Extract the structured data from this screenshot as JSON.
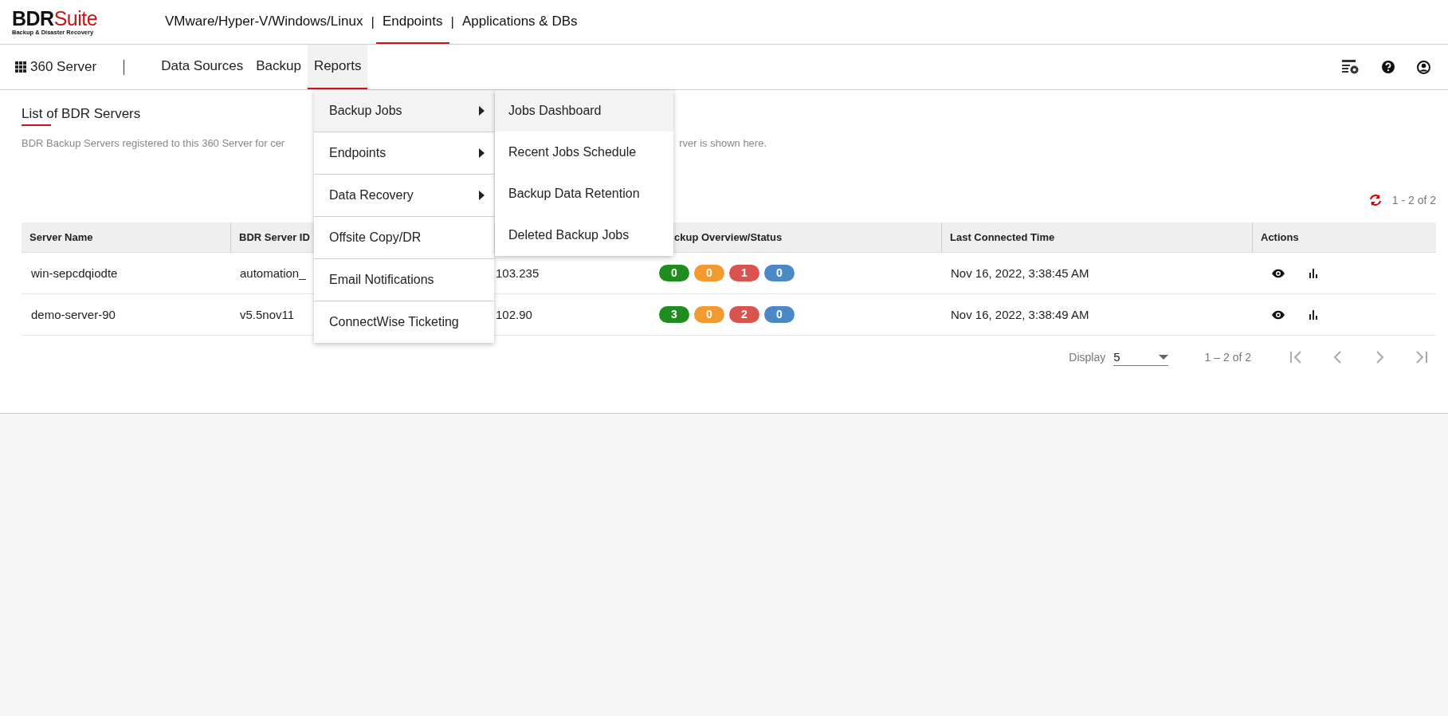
{
  "logo": {
    "brand_dark": "BDR",
    "brand_red": "Suite",
    "tagline": "Backup & Disaster Recovery"
  },
  "top_nav_separators": [
    "|",
    "|"
  ],
  "top_nav": [
    {
      "label": "VMware/Hyper-V/Windows/Linux",
      "selected": false
    },
    {
      "label": "Endpoints",
      "selected": true
    },
    {
      "label": "Applications & DBs",
      "selected": false
    }
  ],
  "sub_nav": {
    "app": "360 Server",
    "items": [
      {
        "label": "Data Sources",
        "selected": false
      },
      {
        "label": "Backup",
        "selected": false
      },
      {
        "label": "Reports",
        "selected": true
      }
    ]
  },
  "reports_menu": [
    {
      "label": "Backup Jobs",
      "selected": true,
      "submenu": true
    },
    {
      "label": "Endpoints",
      "selected": false,
      "submenu": true
    },
    {
      "label": "Data Recovery",
      "selected": false,
      "submenu": true
    },
    {
      "label": "Offsite Copy/DR",
      "selected": false,
      "submenu": false
    },
    {
      "label": "Email Notifications",
      "selected": false,
      "submenu": false
    },
    {
      "label": "ConnectWise Ticketing",
      "selected": false,
      "submenu": false
    }
  ],
  "backup_jobs_submenu": [
    {
      "label": "Jobs Dashboard",
      "selected": true
    },
    {
      "label": "Recent Jobs Schedule",
      "selected": false
    },
    {
      "label": "Backup Data Retention",
      "selected": false
    },
    {
      "label": "Deleted Backup Jobs",
      "selected": false
    }
  ],
  "page": {
    "title": "List of BDR Servers",
    "description_start": "BDR Backup Servers registered to this 360 Server for cer",
    "description_end": "rver is shown here.",
    "range": "1 - 2 of 2"
  },
  "table": {
    "columns": [
      "Server Name",
      "BDR Server ID",
      "",
      "ckup Overview/Status",
      "Last Connected Time",
      "Actions"
    ],
    "rows": [
      {
        "server_name": "win-sepcdqiodte",
        "server_id": "automation_",
        "column_3": "103.235",
        "status": [
          {
            "count": "0",
            "color": "#1e8c1e"
          },
          {
            "count": "0",
            "color": "#f39a2e"
          },
          {
            "count": "1",
            "color": "#d9534f"
          },
          {
            "count": "0",
            "color": "#4a88c6"
          }
        ],
        "last_connected": "Nov 16, 2022, 3:38:45 AM"
      },
      {
        "server_name": "demo-server-90",
        "server_id": "v5.5nov11",
        "column_3": "102.90",
        "status": [
          {
            "count": "3",
            "color": "#1e8c1e"
          },
          {
            "count": "0",
            "color": "#f39a2e"
          },
          {
            "count": "2",
            "color": "#d9534f"
          },
          {
            "count": "0",
            "color": "#4a88c6"
          }
        ],
        "last_connected": "Nov 16, 2022, 3:38:49 AM"
      }
    ]
  },
  "pagination": {
    "display_label": "Display",
    "page_size": "5",
    "range": "1 – 2 of 2"
  }
}
